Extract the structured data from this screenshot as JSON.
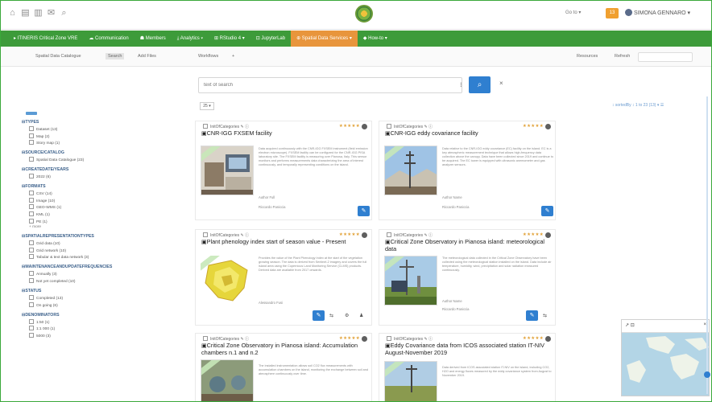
{
  "topbar": {
    "icons": [
      "home-icon",
      "folder-icon",
      "document-icon",
      "envelope-icon",
      "search-icon"
    ],
    "lang": "Go to ▾",
    "notif_count": "13",
    "user_name": "SIMONA GENNARO ▾"
  },
  "nav": {
    "items": [
      {
        "label": "▸ ITINERIS Critical Zone VRE"
      },
      {
        "label": "☁ Communication"
      },
      {
        "label": "☗ Members"
      },
      {
        "label": "⤓ Analytics ▾"
      },
      {
        "label": "⊞ RStudio 4 ▾"
      },
      {
        "label": "⊡ JupyterLab"
      },
      {
        "label": "⊕ Spatial Data Services ▾",
        "active": true
      },
      {
        "label": "◆ How-to ▾"
      }
    ],
    "accent": "#3d9b3a",
    "active_color": "#e8953c"
  },
  "toolbar": {
    "catalog": "Spatial Data Catalogue",
    "search": "Search",
    "my_files": "Add Files",
    "workflows": "Workflows",
    "plus": "+",
    "resources": "Resources",
    "refresh": "Refresh"
  },
  "search": {
    "placeholder": "text of search",
    "button_icon": "search-icon",
    "clear": "×"
  },
  "sidebar": {
    "facets": [
      {
        "heading": "TYPES",
        "items": [
          "Dataset (13)",
          "Map (2)",
          "Story map (1)"
        ]
      },
      {
        "heading": "SOURCE/CATALOG",
        "items": [
          "Spatial Data Catalogue (23)"
        ]
      },
      {
        "heading": "CREATEDATE/YEARS",
        "items": [
          "2022 (6)"
        ]
      },
      {
        "heading": "FORMATS",
        "items": [
          "CSV (14)",
          "Image (10)",
          "GEO-WMS (1)",
          "KML (1)",
          "PE (1)"
        ],
        "more": "+ more"
      },
      {
        "heading": "SPATIALREPRESENTATIONTYPES",
        "items": [
          "Grid data (10)",
          "Grid network (10)",
          "Tabular & text data network (3)"
        ]
      },
      {
        "heading": "MAINTENANCEANDUPDATEFREQUENCIES",
        "items": [
          "Annually (3)",
          "Not yet completed (10)"
        ]
      },
      {
        "heading": "STATUS",
        "items": [
          "Completed (13)",
          "On going (6)"
        ]
      },
      {
        "heading": "DENOMINATORS",
        "items": [
          "1:50 (1)",
          "1:1 000 (1)",
          "5000 (3)"
        ]
      }
    ]
  },
  "results": {
    "pager": "25 ▾",
    "sort_info": "↕ sortedBy   ↕ 1 to 23 (13) ▾   ☰",
    "cards": [
      {
        "meta": "InitOfCategories ✎ ⓘ",
        "stars": "★★★★★",
        "title": "CNR-IGG FXSEM facility",
        "desc": "Data acquired continuously with the CNR-IGG FXSEM instrument (field emission electron microscope). FXSEM facility can be configured for the CNR-IGG PISA laboratory site. The FXSEM facility is measuring over Pianosa, Italy. This sensor monitors and performs measurements data characterizing the area of interest continuously, and temporally representing conditions on the island.",
        "author": "Author Full",
        "contact": "Riccardo Paniccia"
      },
      {
        "meta": "InitOfCategories ✎ ⓘ",
        "stars": "★★★★★",
        "title": "CNR-IGG eddy covariance facility",
        "desc": "Data relative to the CNR-IGG eddy covariance (EC) facility on the island. EC is a key atmospheric measurement technique that allows high-frequency data collection above the canopy. Data have been collected since 2019 and continue to be acquired. The EC tower is equipped with ultrasonic anemometer and gas analyzer sensors.",
        "author": "Author Name",
        "contact": "Riccardo Paniccia"
      },
      {
        "meta": "InitOfCategories ✎ ⓘ",
        "stars": "★★★★★",
        "title": "Plant phenology index start of season value - Present",
        "desc": "Provides the value of the Plant Phenology Index at the start of the vegetation growing season. The data is derived from Sentinel-2 imagery and covers the full island area using the Copernicus Land Monitoring Service (CLMS) products. Derived data are available from 2017 onwards.",
        "author": "Alessandro Fusi",
        "contact": ""
      },
      {
        "meta": "InitOfCategories ✎ ⓘ",
        "stars": "★★★★★",
        "title": "Critical Zone Observatory in Pianosa island: meteorological data",
        "desc": "The meteorological data collected in the Critical Zone Observatory have been collected using the meteorological station installed on the island. Data include air temperature, humidity, wind, precipitation and solar radiation measured continuously.",
        "author": "Author Name",
        "contact": "Riccardo Paniccia"
      },
      {
        "meta": "InitOfCategories ✎ ⓘ",
        "stars": "★★★★★",
        "title": "Critical Zone Observatory in Pianosa island: Accumulation chambers n.1 and n.2",
        "desc": "The installed instrumentation allows soil CO2 flux measurements with accumulation chambers on the island, monitoring the exchange between soil and atmosphere continuously over time.",
        "author": "",
        "contact": ""
      },
      {
        "meta": "InitOfCategories ✎ ⓘ",
        "stars": "★★★★★",
        "title": "Eddy Covariance data from ICOS associated station IT-NIV August-November 2019",
        "desc": "Data derived from ICOS associated station IT-NIV on the island, including CO2, H2O and energy fluxes measured by the eddy covariance system from August to November 2019.",
        "author": "",
        "contact": ""
      }
    ]
  },
  "map": {
    "zoom_icon": "↗ ⊡",
    "close": "×"
  }
}
